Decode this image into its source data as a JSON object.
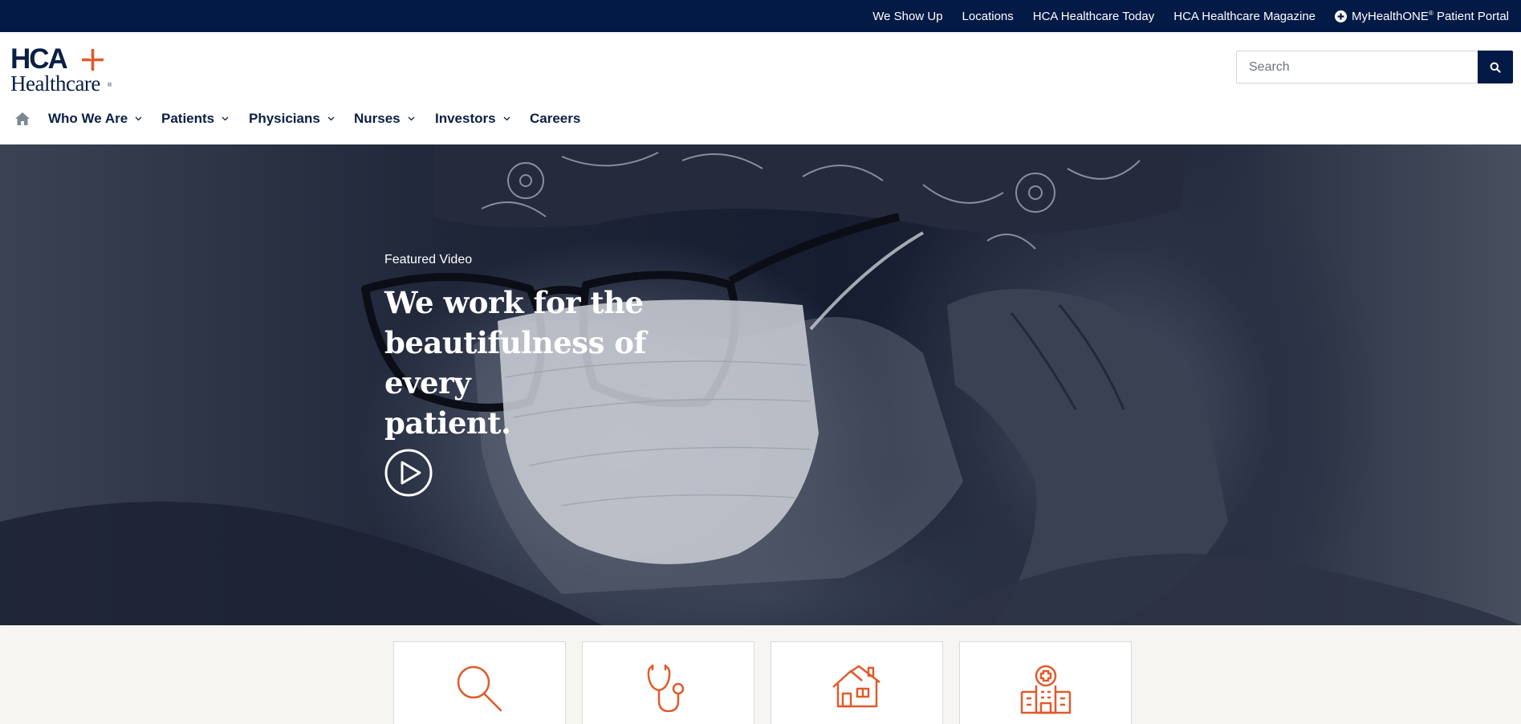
{
  "utility_nav": {
    "items": [
      "We Show Up",
      "Locations",
      "HCA Healthcare Today",
      "HCA Healthcare Magazine"
    ],
    "portal_label": "MyHealthONE",
    "portal_reg": "®",
    "portal_suffix": " Patient Portal"
  },
  "logo": {
    "line1": "HCA",
    "line2": "Healthcare",
    "reg": "®"
  },
  "search": {
    "placeholder": "Search"
  },
  "main_nav": {
    "home_icon": "home-icon",
    "items": [
      "Who We Are",
      "Patients",
      "Physicians",
      "Nurses",
      "Investors",
      "Careers"
    ]
  },
  "hero": {
    "eyebrow": "Featured Video",
    "headline_line1": "We work for the",
    "headline_line2": "beautifulness of every",
    "headline_line3": "patient.",
    "play_icon": "play-icon"
  },
  "cards": [
    {
      "icon": "search-icon"
    },
    {
      "icon": "stethoscope-icon"
    },
    {
      "icon": "house-icon"
    },
    {
      "icon": "hospital-icon"
    }
  ],
  "colors": {
    "navy": "#021a45",
    "brand_orange": "#e05a2b",
    "text_dark": "#0b1f44",
    "strip_bg": "#f6f5f2"
  }
}
